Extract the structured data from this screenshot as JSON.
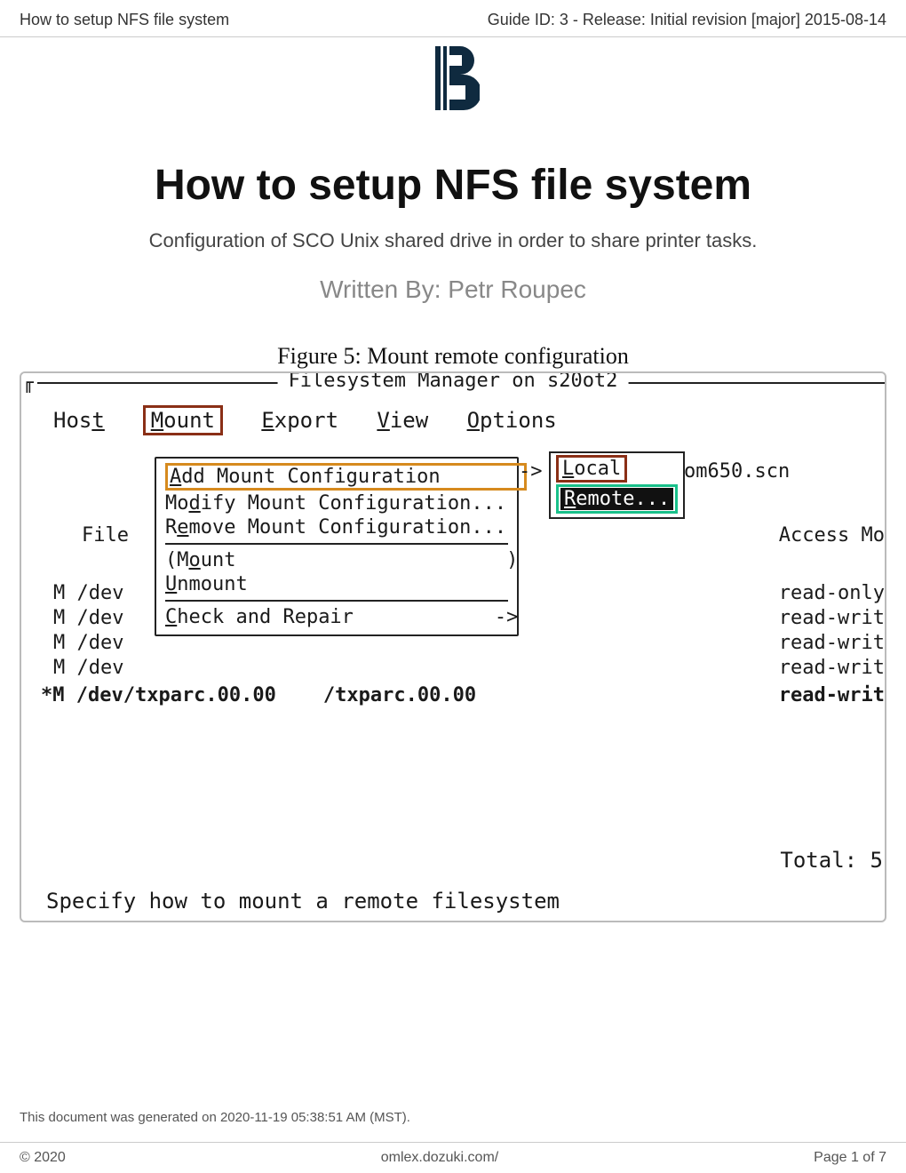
{
  "header": {
    "left": "How to setup NFS file system",
    "right": "Guide ID: 3 - Release: Initial revision [major] 2015-08-14"
  },
  "title": "How to setup NFS file system",
  "subtitle": "Configuration of SCO Unix shared drive in order to share printer tasks.",
  "byline": "Written By: Petr Roupec",
  "figure": {
    "caption": "Figure 5: Mount remote configuration",
    "window_title": "Filesystem Manager on s20ot2",
    "menubar": {
      "host": "Host",
      "mount": "Mount",
      "export": "Export",
      "view": "View",
      "options": "Options"
    },
    "dropdown": {
      "add": "Add Mount Configuration",
      "modify": "Modify Mount Configuration...",
      "remove": "Remove Mount Configuration...",
      "mount_open": "(Mount",
      "mount_close": ")",
      "unmount": "Unmount",
      "check": "Check and Repair",
      "arrow": "->"
    },
    "submenu": {
      "local": "Local",
      "remote": "Remote..."
    },
    "right_label": "om650.scn",
    "col_file": "File",
    "col_access": "Access Mo",
    "rows": {
      "dev1": "M /dev",
      "dev2": "M /dev",
      "dev3": "M /dev",
      "dev4": "M /dev",
      "a1": "read-only",
      "a2": "read-writ",
      "a3": "read-writ",
      "a4": "read-writ"
    },
    "bold_row_left": "*M /dev/txparc.00.00    /txparc.00.00",
    "bold_row_right": "read-writ",
    "total": "Total: 5",
    "status": "Specify how to mount a remote filesystem"
  },
  "gen_note": "This document was generated on 2020-11-19 05:38:51 AM (MST).",
  "footer": {
    "left": "© 2020",
    "center": "omlex.dozuki.com/",
    "right": "Page 1 of 7"
  }
}
